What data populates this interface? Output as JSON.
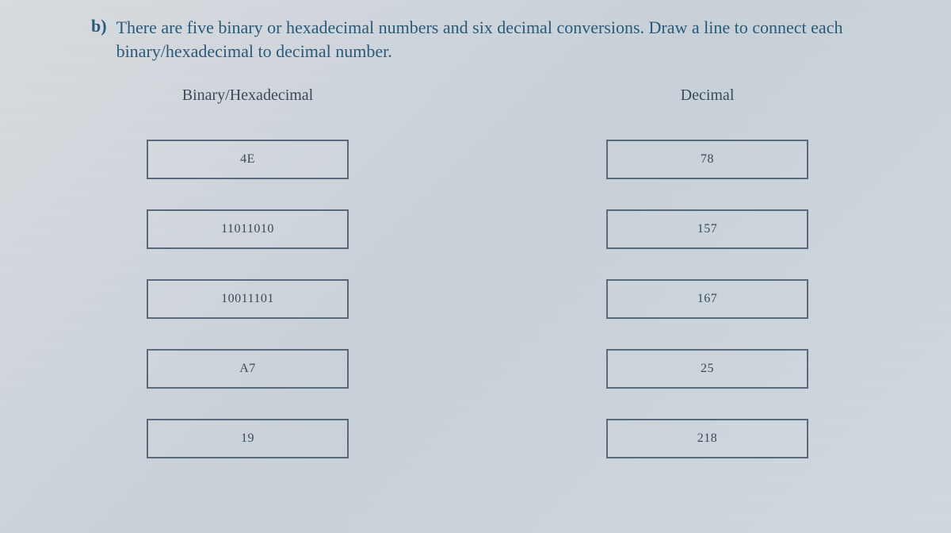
{
  "question": {
    "letter": "b)",
    "text": "There are five binary or hexadecimal numbers and six decimal conversions. Draw a line to connect each binary/hexadecimal to decimal number."
  },
  "columns": {
    "left": {
      "header": "Binary/Hexadecimal",
      "items": [
        "4E",
        "11011010",
        "10011101",
        "A7",
        "19"
      ]
    },
    "right": {
      "header": "Decimal",
      "items": [
        "78",
        "157",
        "167",
        "25",
        "218"
      ]
    }
  }
}
